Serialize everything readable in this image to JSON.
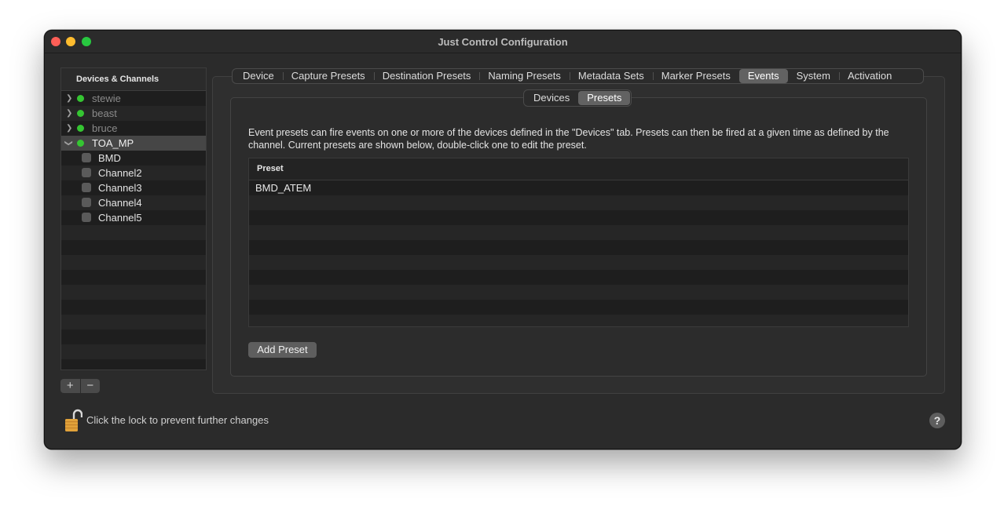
{
  "window": {
    "title": "Just Control Configuration"
  },
  "sidebar": {
    "header": "Devices & Channels",
    "devices": [
      {
        "name": "stewie",
        "status_color": "#35c532",
        "expanded": false
      },
      {
        "name": "beast",
        "status_color": "#35c532",
        "expanded": false
      },
      {
        "name": "bruce",
        "status_color": "#35c532",
        "expanded": false
      },
      {
        "name": "TOA_MP",
        "status_color": "#35c532",
        "expanded": true,
        "selected": true
      }
    ],
    "channels": [
      "BMD",
      "Channel2",
      "Channel3",
      "Channel4",
      "Channel5"
    ],
    "add_label": "+",
    "remove_label": "−"
  },
  "tabs": {
    "items": [
      "Device",
      "Capture Presets",
      "Destination Presets",
      "Naming Presets",
      "Metadata Sets",
      "Marker Presets",
      "Events",
      "System",
      "Activation"
    ],
    "active": "Events"
  },
  "subtabs": {
    "items": [
      "Devices",
      "Presets"
    ],
    "active": "Presets"
  },
  "events": {
    "description": "Event presets can fire events on one or more of the devices defined in the \"Devices\" tab. Presets can then be fired at a given time as defined by the channel. Current presets are shown below, double-click one to edit the preset.",
    "table_header": "Preset",
    "presets": [
      "BMD_ATEM"
    ],
    "add_button": "Add Preset"
  },
  "footer": {
    "lock_text": "Click the lock to prevent further changes",
    "help_label": "?"
  }
}
